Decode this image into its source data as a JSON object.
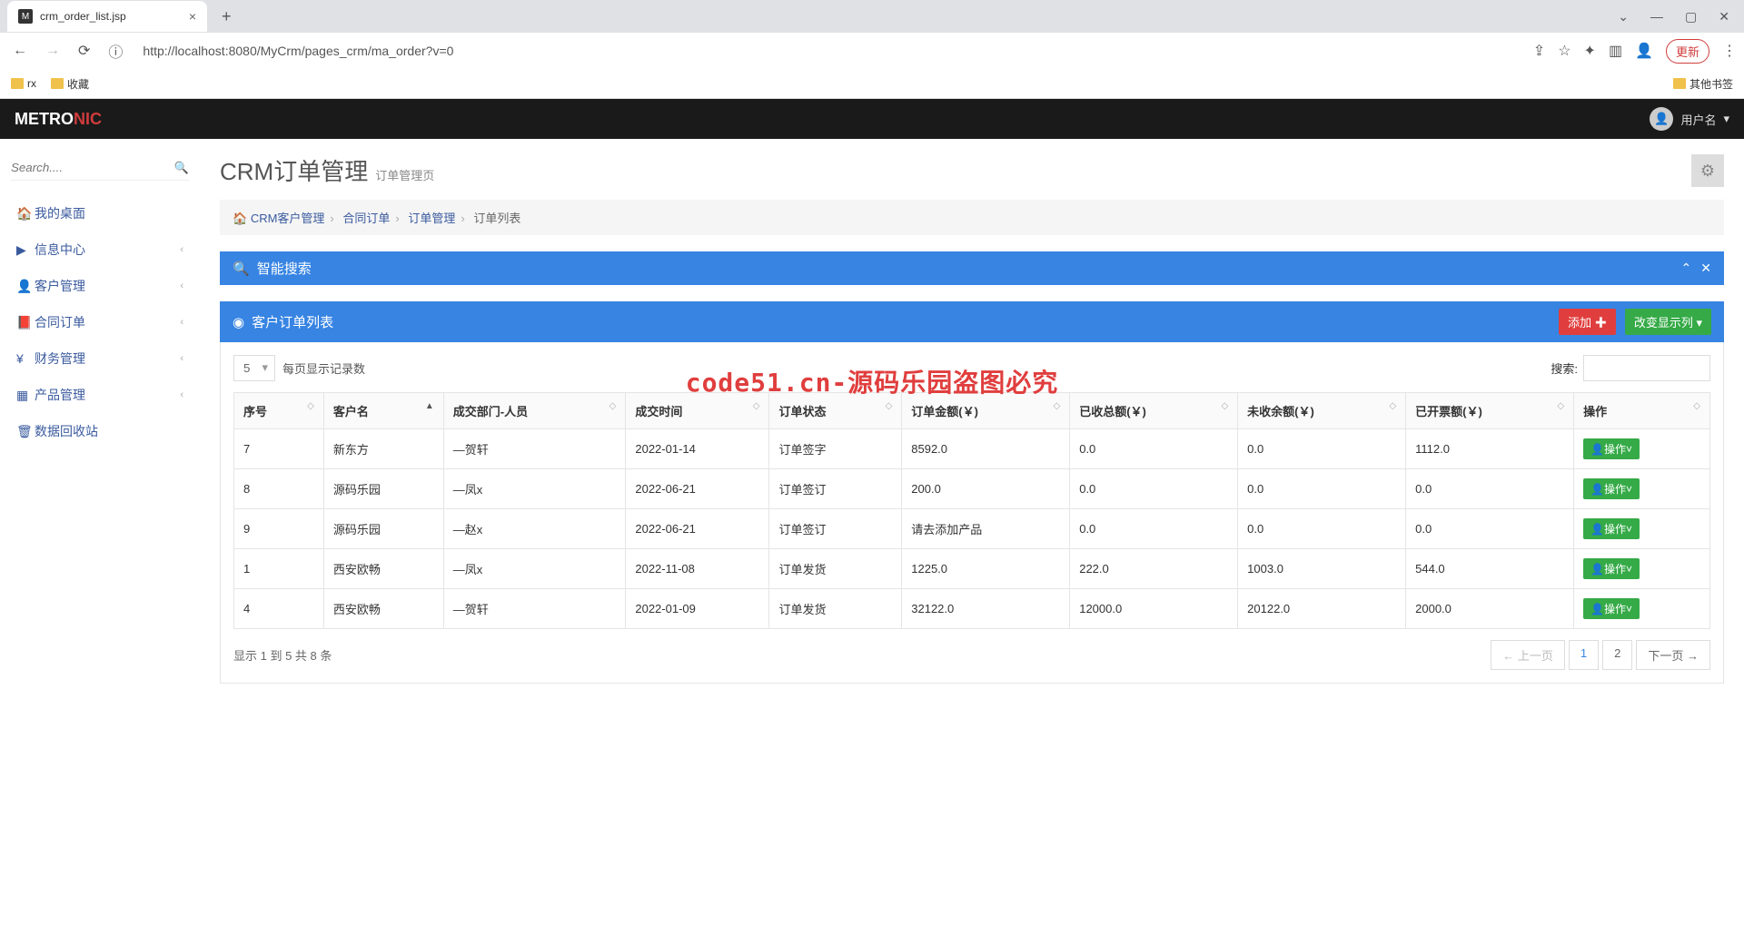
{
  "browser": {
    "tab_title": "crm_order_list.jsp",
    "url": "http://localhost:8080/MyCrm/pages_crm/ma_order?v=0",
    "update_btn": "更新",
    "bookmarks": [
      "rx",
      "收藏"
    ],
    "other_bookmarks": "其他书签"
  },
  "header": {
    "logo_a": "METRO",
    "logo_b": "NIC",
    "user_label": "用户名"
  },
  "sidebar": {
    "search_placeholder": "Search....",
    "items": [
      {
        "label": "我的桌面"
      },
      {
        "label": "信息中心"
      },
      {
        "label": "客户管理"
      },
      {
        "label": "合同订单"
      },
      {
        "label": "财务管理"
      },
      {
        "label": "产品管理"
      },
      {
        "label": "数据回收站"
      }
    ]
  },
  "page": {
    "title": "CRM订单管理",
    "subtitle": "订单管理页"
  },
  "breadcrumb": {
    "items": [
      "CRM客户管理",
      "合同订单",
      "订单管理",
      "订单列表"
    ]
  },
  "search_panel": {
    "title": "智能搜索"
  },
  "list_panel": {
    "title": "客户订单列表",
    "add_btn": "添加",
    "change_cols_btn": "改变显示列",
    "page_size_value": "5",
    "page_size_label": "每页显示记录数",
    "search_label": "搜索:",
    "columns": [
      "序号",
      "客户名",
      "成交部门-人员",
      "成交时间",
      "订单状态",
      "订单金额(￥)",
      "已收总额(￥)",
      "未收余额(￥)",
      "已开票额(￥)",
      "操作"
    ],
    "rows": [
      {
        "seq": "7",
        "cust": "新东方",
        "dept": "—贺轩",
        "time": "2022-01-14",
        "status": "订单签字",
        "amount": "8592.0",
        "received": "0.0",
        "unpaid": "0.0",
        "invoiced": "1112.0"
      },
      {
        "seq": "8",
        "cust": "源码乐园",
        "dept": "—凤x",
        "time": "2022-06-21",
        "status": "订单签订",
        "amount": "200.0",
        "received": "0.0",
        "unpaid": "0.0",
        "invoiced": "0.0"
      },
      {
        "seq": "9",
        "cust": "源码乐园",
        "dept": "—赵x",
        "time": "2022-06-21",
        "status": "订单签订",
        "amount": "请去添加产品",
        "received": "0.0",
        "unpaid": "0.0",
        "invoiced": "0.0"
      },
      {
        "seq": "1",
        "cust": "西安欧畅",
        "dept": "—凤x",
        "time": "2022-11-08",
        "status": "订单发货",
        "amount": "1225.0",
        "received": "222.0",
        "unpaid": "1003.0",
        "invoiced": "544.0"
      },
      {
        "seq": "4",
        "cust": "西安欧畅",
        "dept": "—贺轩",
        "time": "2022-01-09",
        "status": "订单发货",
        "amount": "32122.0",
        "received": "12000.0",
        "unpaid": "20122.0",
        "invoiced": "2000.0"
      }
    ],
    "op_label": "操作",
    "info_text": "显示 1 到 5 共 8 条",
    "prev": "← 上一页",
    "next": "下一页 →",
    "pages": [
      "1",
      "2"
    ]
  },
  "watermark": "code51.cn-源码乐园盗图必究"
}
